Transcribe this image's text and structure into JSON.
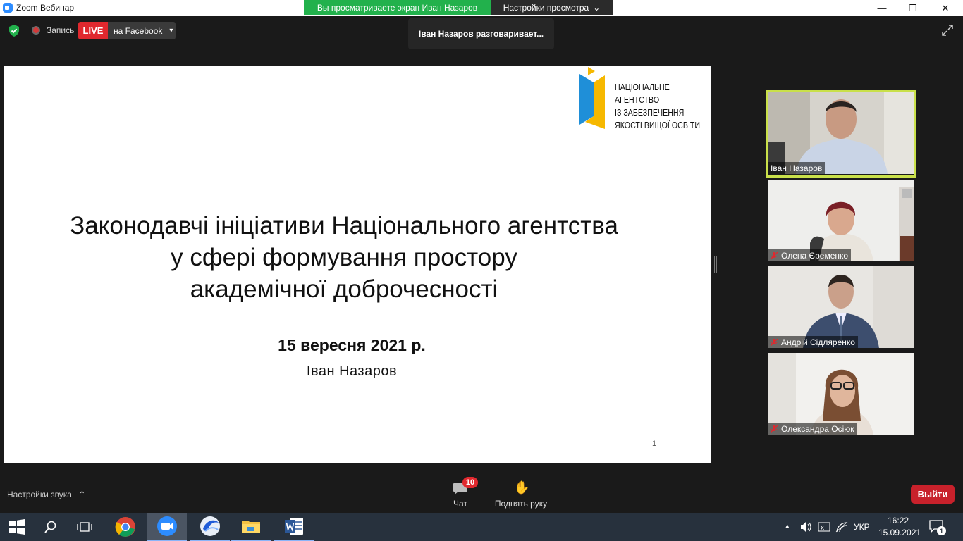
{
  "window": {
    "app_title": "Zoom Вебинар",
    "minimize_glyph": "—",
    "restore_glyph": "❐",
    "close_glyph": "✕"
  },
  "share_banner": {
    "text": "Вы просматриваете экран Иван Назаров",
    "view_options_label": "Настройки просмотра",
    "view_options_glyph": "⌄"
  },
  "top_controls": {
    "record_label": "Запись",
    "live_label": "LIVE",
    "live_target": "на Facebook",
    "live_target_glyph": "▾"
  },
  "speaking_notice": "Іван Назаров разговаривает...",
  "slide": {
    "logo_text": "НАЦІОНАЛЬНЕ\nАГЕНТСТВО\nІЗ ЗАБЕЗПЕЧЕННЯ\nЯКОСТІ ВИЩОЇ ОСВІТИ",
    "title_line1": "Законодавчі ініціативи Національного агентства",
    "title_line2": "у сфері формування простору",
    "title_line3": "академічної доброчесності",
    "date": "15 вересня 2021 р.",
    "author": "Іван Назаров",
    "page_number": "1",
    "colors": {
      "logo_blue": "#1f8fd8",
      "logo_yellow": "#f6b800"
    }
  },
  "participants": [
    {
      "name": "Іван Назаров",
      "muted": false,
      "active_speaker": true
    },
    {
      "name": "Олена Єременко",
      "muted": true,
      "active_speaker": false
    },
    {
      "name": "Андрій Сідляренко",
      "muted": true,
      "active_speaker": false
    },
    {
      "name": "Олександра Осіюк",
      "muted": true,
      "active_speaker": false
    }
  ],
  "bottom_bar": {
    "audio_settings_label": "Настройки звука",
    "audio_settings_glyph": "⌃",
    "chat_label": "Чат",
    "chat_badge": "10",
    "raise_hand_label": "Поднять руку",
    "raise_hand_glyph": "✋",
    "leave_label": "Выйти"
  },
  "taskbar": {
    "apps": [
      "start-icon",
      "search-icon",
      "task-view-icon",
      "chrome-icon",
      "zoom-icon",
      "browser-icon",
      "file-explorer-icon",
      "word-icon"
    ],
    "tray": {
      "language": "УКР",
      "time": "16:22",
      "date": "15.09.2021",
      "notifications_count": "1",
      "caret_glyph": "▴"
    }
  }
}
